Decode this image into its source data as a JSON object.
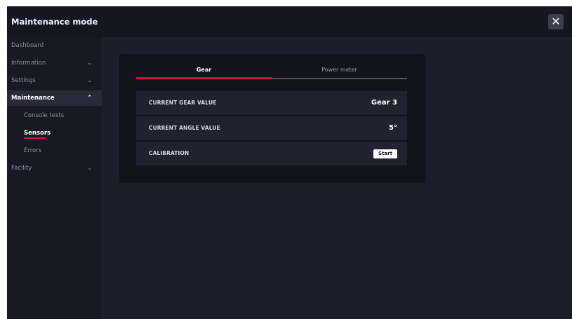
{
  "window": {
    "title": "Maintenance mode",
    "close_label": "✕"
  },
  "sidebar": {
    "items": [
      {
        "label": "Dashboard",
        "chevron": ""
      },
      {
        "label": "Information",
        "chevron": "⌄"
      },
      {
        "label": "Settings",
        "chevron": "⌄"
      },
      {
        "label": "Maintenance",
        "chevron": "⌃"
      },
      {
        "label": "Facility",
        "chevron": "⌄"
      }
    ],
    "subitems": [
      {
        "label": "Console tests"
      },
      {
        "label": "Sensors"
      },
      {
        "label": "Errors"
      }
    ]
  },
  "tabs": [
    {
      "label": "Gear"
    },
    {
      "label": "Power meter"
    }
  ],
  "rows": [
    {
      "label": "CURRENT GEAR VALUE",
      "value": "Gear 3"
    },
    {
      "label": "CURRENT ANGLE VALUE",
      "value": "5°"
    },
    {
      "label": "CALIBRATION",
      "button": "Start"
    }
  ],
  "colors": {
    "accent": "#d4103a",
    "background": "#1d1d2b",
    "sidebar": "#191926",
    "panel": "#13131c"
  }
}
